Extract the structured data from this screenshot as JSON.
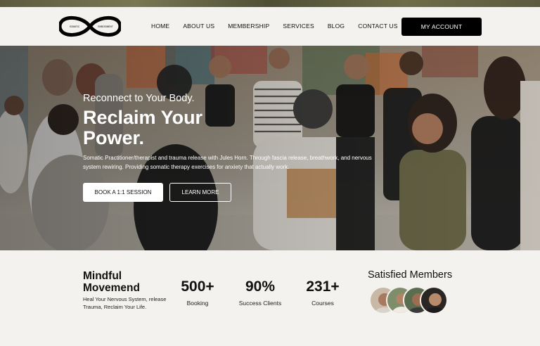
{
  "brand": {
    "logo_left": "SOMATIC",
    "logo_right": "EMBODIMENT"
  },
  "nav": {
    "items": [
      {
        "label": "HOME"
      },
      {
        "label": "ABOUT US"
      },
      {
        "label": "MEMBERSHIP"
      },
      {
        "label": "SERVICES"
      },
      {
        "label": "BLOG"
      },
      {
        "label": "CONTACT US"
      }
    ],
    "account_label": "MY ACCOUNT"
  },
  "hero": {
    "eyebrow": "Reconnect to Your Body.",
    "headline": "Reclaim Your Power.",
    "description": "Somatic Practitioner/therapist and trauma release with Jules Horn. Through fascia release, breathwork, and nervous system rewiring. Providing somatic therapy exercises for anxiety that actually work.",
    "primary_button": "BOOK A 1:1 SESSION",
    "secondary_button": "LEARN MORE"
  },
  "stats": {
    "brand_title": "Mindful Movemend",
    "brand_tagline": "Heal Your Nervous System, release Trauma, Reclaim Your Life.",
    "items": [
      {
        "value": "500+",
        "label": "Booking"
      },
      {
        "value": "90%",
        "label": "Success Clients"
      },
      {
        "value": "231+",
        "label": "Courses"
      }
    ],
    "members_title": "Satisfied Members"
  }
}
